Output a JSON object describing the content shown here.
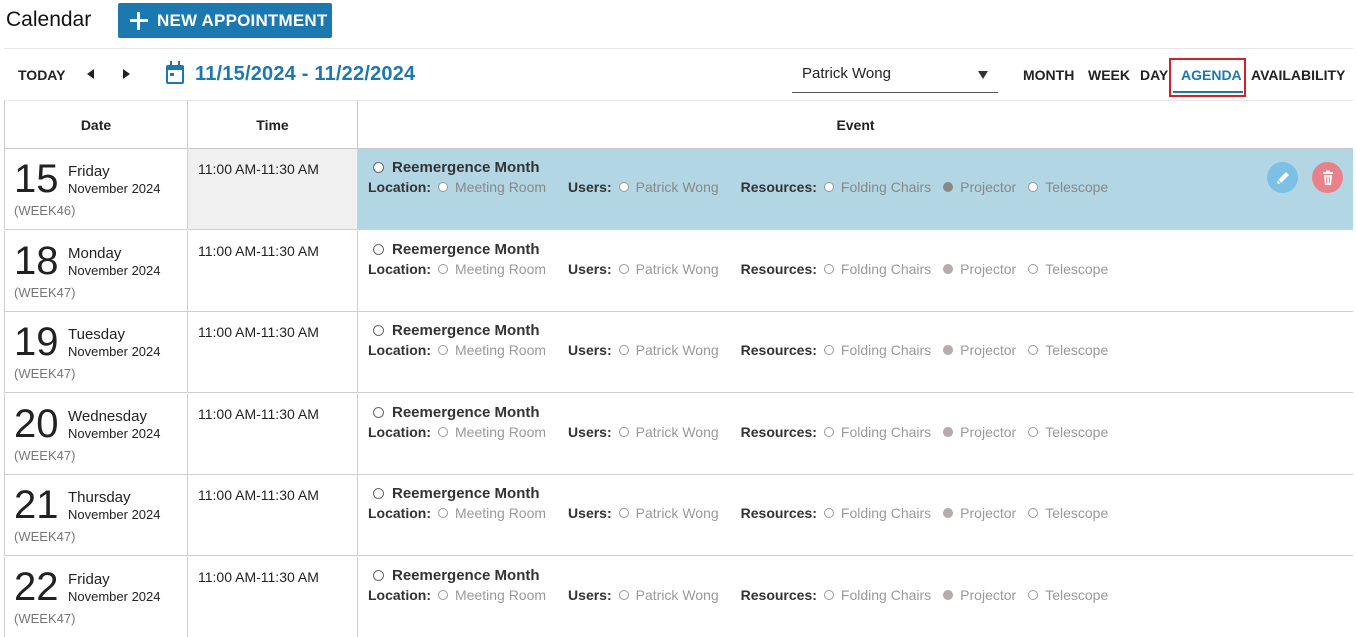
{
  "header": {
    "title": "Calendar",
    "new_appointment_label": "NEW APPOINTMENT"
  },
  "toolbar": {
    "today_label": "TODAY",
    "date_range": "11/15/2024 - 11/22/2024",
    "selected_user": "Patrick Wong",
    "views": {
      "month": "MONTH",
      "week": "WEEK",
      "day": "DAY",
      "agenda": "AGENDA",
      "availability": "AVAILABILITY"
    },
    "active_view": "AGENDA"
  },
  "columns": {
    "date": "Date",
    "time": "Time",
    "event": "Event"
  },
  "labels": {
    "location": "Location:",
    "users": "Users:",
    "resources": "Resources:"
  },
  "colors": {
    "accent": "#1c79b0",
    "selected_row": "#b2d6e4",
    "highlight_border": "#d42128",
    "edit_button": "#7cc0e6",
    "delete_button": "#e9818a"
  },
  "rows": [
    {
      "day": "15",
      "weekday": "Friday",
      "month_year": "November 2024",
      "week": "(WEEK46)",
      "time": "11:00 AM-11:30 AM",
      "title": "Reemergence Month",
      "location": "Meeting Room",
      "user": "Patrick Wong",
      "resources": [
        "Folding Chairs",
        "Projector",
        "Telescope"
      ],
      "selected": true
    },
    {
      "day": "18",
      "weekday": "Monday",
      "month_year": "November 2024",
      "week": "(WEEK47)",
      "time": "11:00 AM-11:30 AM",
      "title": "Reemergence Month",
      "location": "Meeting Room",
      "user": "Patrick Wong",
      "resources": [
        "Folding Chairs",
        "Projector",
        "Telescope"
      ]
    },
    {
      "day": "19",
      "weekday": "Tuesday",
      "month_year": "November 2024",
      "week": "(WEEK47)",
      "time": "11:00 AM-11:30 AM",
      "title": "Reemergence Month",
      "location": "Meeting Room",
      "user": "Patrick Wong",
      "resources": [
        "Folding Chairs",
        "Projector",
        "Telescope"
      ]
    },
    {
      "day": "20",
      "weekday": "Wednesday",
      "month_year": "November 2024",
      "week": "(WEEK47)",
      "time": "11:00 AM-11:30 AM",
      "title": "Reemergence Month",
      "location": "Meeting Room",
      "user": "Patrick Wong",
      "resources": [
        "Folding Chairs",
        "Projector",
        "Telescope"
      ]
    },
    {
      "day": "21",
      "weekday": "Thursday",
      "month_year": "November 2024",
      "week": "(WEEK47)",
      "time": "11:00 AM-11:30 AM",
      "title": "Reemergence Month",
      "location": "Meeting Room",
      "user": "Patrick Wong",
      "resources": [
        "Folding Chairs",
        "Projector",
        "Telescope"
      ]
    },
    {
      "day": "22",
      "weekday": "Friday",
      "month_year": "November 2024",
      "week": "(WEEK47)",
      "time": "11:00 AM-11:30 AM",
      "title": "Reemergence Month",
      "location": "Meeting Room",
      "user": "Patrick Wong",
      "resources": [
        "Folding Chairs",
        "Projector",
        "Telescope"
      ]
    }
  ]
}
